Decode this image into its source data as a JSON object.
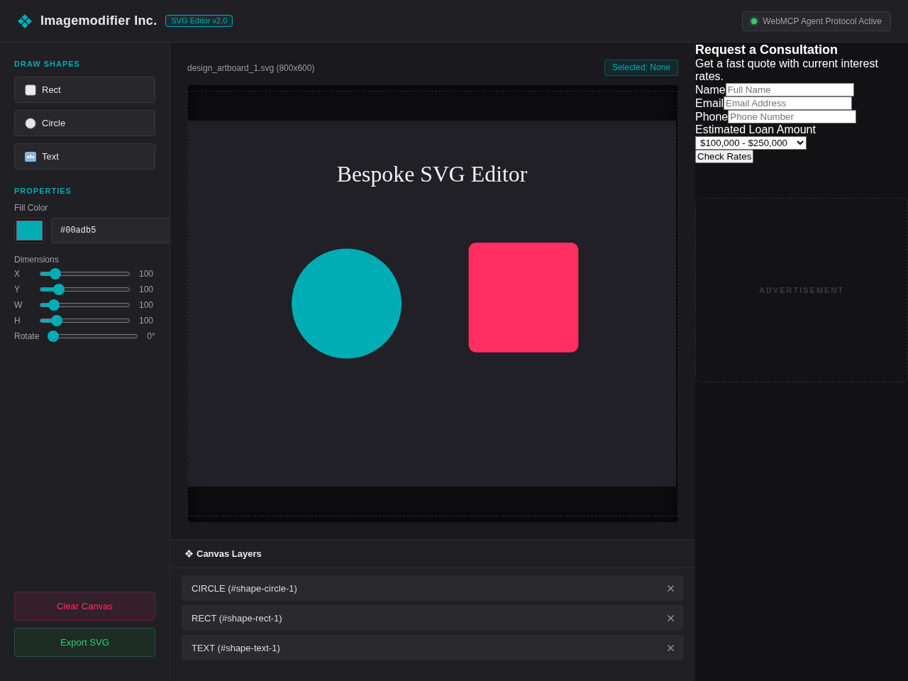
{
  "header": {
    "title": "Imagemodifier Inc.",
    "badge": "SVG Editor v2.0",
    "status": {
      "label": "WebMCP Agent Protocol Active",
      "on": true
    }
  },
  "sidebar": {
    "draw_shapes": {
      "heading": "DRAW SHAPES",
      "tools": [
        {
          "kind": "rect",
          "label": "Rect"
        },
        {
          "kind": "circle",
          "label": "Circle"
        },
        {
          "kind": "text",
          "label": "Text"
        }
      ]
    },
    "properties": {
      "heading": "PROPERTIES",
      "fill": {
        "label": "Fill Color",
        "value": "#00adb5",
        "color": "#00adb5"
      },
      "dimensions_label": "Dimensions",
      "sliders": [
        {
          "label": "X",
          "level": 0.125,
          "reading": "100"
        },
        {
          "label": "Y",
          "level": 0.167,
          "reading": "100"
        },
        {
          "label": "W",
          "level": 0.11,
          "reading": "100"
        },
        {
          "label": "H",
          "level": 0.14,
          "reading": "100"
        },
        {
          "label": "Rotate",
          "level": 0,
          "reading": "0°"
        }
      ]
    },
    "actions": [
      {
        "kind": "danger",
        "label": "Clear Canvas"
      },
      {
        "kind": "success",
        "label": "Export SVG"
      }
    ]
  },
  "canvas": {
    "file_label": "design_artboard_1.svg (800x600)",
    "selection": "Selected: None",
    "shapes": [
      {
        "kind": "text",
        "text": "Bespoke SVG Editor"
      },
      {
        "kind": "circle",
        "color": "#00adb5"
      },
      {
        "kind": "rect",
        "color": "#ff2e63"
      }
    ]
  },
  "layers": {
    "title": "Canvas Layers",
    "items": [
      {
        "label": "CIRCLE (#shape-circle-1)",
        "selected": false
      },
      {
        "label": "RECT (#shape-rect-1)",
        "selected": false
      },
      {
        "label": "TEXT (#shape-text-1)",
        "selected": false
      }
    ]
  },
  "consultation_form": {
    "title": "Request a Consultation",
    "subtitle": "Get a fast quote with current interest rates.",
    "fields": [
      {
        "label": "Name",
        "placeholder": "Full Name"
      },
      {
        "label": "Email",
        "placeholder": "Email Address"
      },
      {
        "label": "Phone",
        "placeholder": "Phone Number"
      }
    ],
    "loan": {
      "label": "Estimated Loan Amount",
      "value": "$100,000 - $250,000"
    },
    "submit": "Check Rates"
  },
  "advertisement": {
    "label": "ADVERTISEMENT"
  }
}
